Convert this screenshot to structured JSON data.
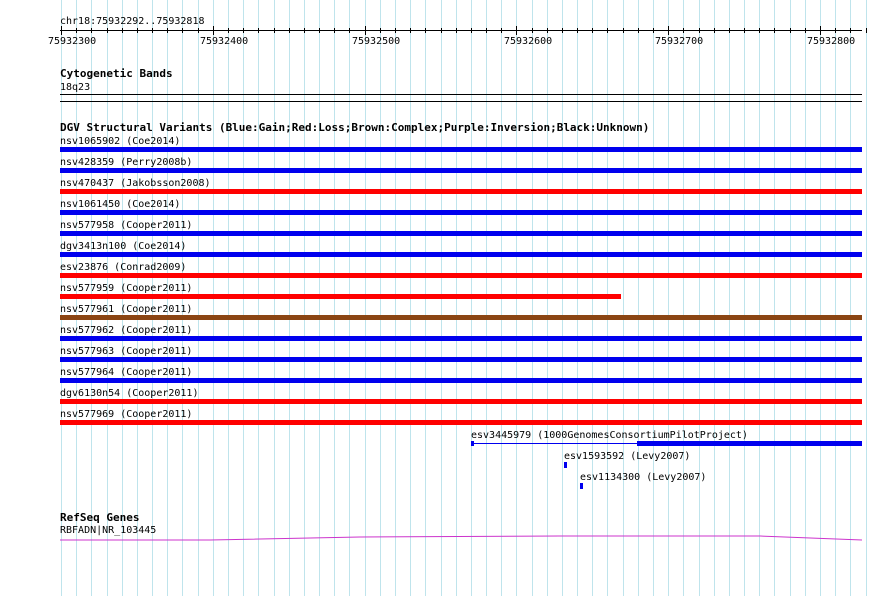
{
  "colors": {
    "grid": "#bfe4ec",
    "gain": "#0000ee",
    "loss": "#ff0000",
    "complex": "#8b4513",
    "gene": "#cc33cc"
  },
  "ruler": {
    "region": "chr18:75932292..75932818",
    "labels": [
      "75932300",
      "75932400",
      "75932500",
      "75932600",
      "75932700",
      "75932800"
    ]
  },
  "cytoband": {
    "title": "Cytogenetic Bands",
    "band": "18q23"
  },
  "dgv": {
    "title": "DGV Structural Variants (Blue:Gain;Red:Loss;Brown:Complex;Purple:Inversion;Black:Unknown)",
    "variants": [
      {
        "label": "nsv1065902 (Coe2014)",
        "type": "gain"
      },
      {
        "label": "nsv428359 (Perry2008b)",
        "type": "gain"
      },
      {
        "label": "nsv470437 (Jakobsson2008)",
        "type": "loss"
      },
      {
        "label": "nsv1061450 (Coe2014)",
        "type": "gain"
      },
      {
        "label": "nsv577958 (Cooper2011)",
        "type": "gain"
      },
      {
        "label": "dgv3413n100 (Coe2014)",
        "type": "gain"
      },
      {
        "label": "esv23876 (Conrad2009)",
        "type": "loss"
      },
      {
        "label": "nsv577959 (Cooper2011)",
        "type": "loss"
      },
      {
        "label": "nsv577961 (Cooper2011)",
        "type": "complex"
      },
      {
        "label": "nsv577962 (Cooper2011)",
        "type": "gain"
      },
      {
        "label": "nsv577963 (Cooper2011)",
        "type": "gain"
      },
      {
        "label": "nsv577964 (Cooper2011)",
        "type": "gain"
      },
      {
        "label": "dgv6130n54 (Cooper2011)",
        "type": "loss"
      },
      {
        "label": "nsv577969 (Cooper2011)",
        "type": "loss"
      },
      {
        "label": "esv3445979 (1000GenomesConsortiumPilotProject)",
        "type": "gain"
      },
      {
        "label": "esv1593592 (Levy2007)",
        "type": "gain"
      },
      {
        "label": "esv1134300 (Levy2007)",
        "type": "gain"
      }
    ]
  },
  "refseq": {
    "title": "RefSeq Genes",
    "gene": "RBFADN|NR_103445"
  }
}
